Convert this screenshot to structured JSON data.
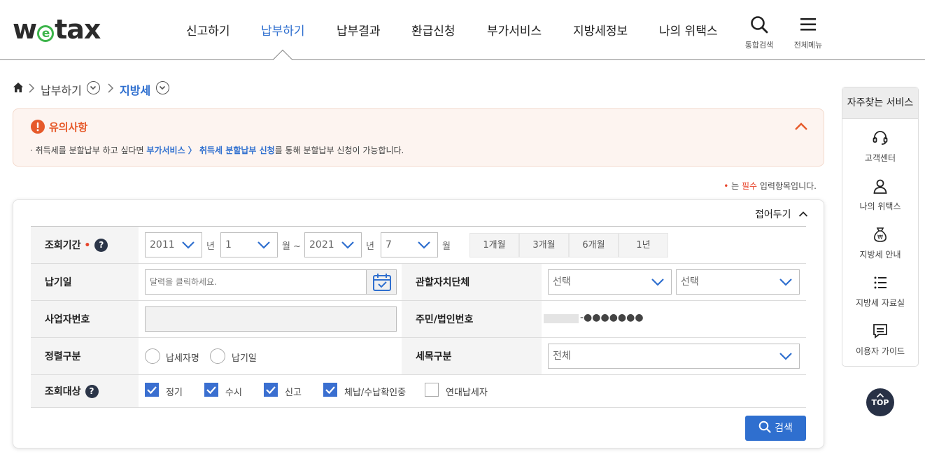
{
  "header": {
    "logo_text": "wetax",
    "nav": [
      "신고하기",
      "납부하기",
      "납부결과",
      "환급신청",
      "부가서비스",
      "지방세정보",
      "나의 위택스"
    ],
    "active_nav": "납부하기",
    "search_label": "통합검색",
    "menu_label": "전체메뉴",
    "accent_color": "#2f6fcf"
  },
  "breadcrumb": {
    "level1": "납부하기",
    "level2": "지방세"
  },
  "notice": {
    "title": "유의사항",
    "text_before": "· 취득세를 분할납부 하고 싶다면 ",
    "text_link": "부가서비스 〉 취득세 분할납부 신청",
    "text_after": "를 통해 분할납부 신청이 가능합니다."
  },
  "required_note": {
    "prefix": "는 ",
    "required": "필수",
    "suffix": " 입력항목입니다."
  },
  "form": {
    "collapse_label": "접어두기",
    "period": {
      "label": "조회기간",
      "from_year": "2011",
      "from_month": "1",
      "to_year": "2021",
      "to_month": "7",
      "unit_year": "년",
      "unit_month_tilde": "월 ~",
      "unit_month": "월",
      "quick_buttons": [
        "1개월",
        "3개월",
        "6개월",
        "1년"
      ]
    },
    "due_date": {
      "label": "납기일",
      "placeholder": "달력을 클릭하세요."
    },
    "jurisdiction": {
      "label": "관할자치단체",
      "select1": "선택",
      "select2": "선택"
    },
    "business_no": {
      "label": "사업자번호",
      "value": ""
    },
    "resident_no": {
      "label": "주민/법인번호",
      "masked": "-●●●●●●●"
    },
    "sort": {
      "label": "정렬구분",
      "options": [
        "납세자명",
        "납기일"
      ]
    },
    "tax_item": {
      "label": "세목구분",
      "value": "전체"
    },
    "target": {
      "label": "조회대상",
      "options": [
        {
          "label": "정기",
          "checked": true
        },
        {
          "label": "수시",
          "checked": true
        },
        {
          "label": "신고",
          "checked": true
        },
        {
          "label": "체납/수납확인중",
          "checked": true
        },
        {
          "label": "연대납세자",
          "checked": false
        }
      ]
    },
    "search_button": "검색"
  },
  "side_panel": {
    "title": "자주찾는 서비스",
    "items": [
      "고객센터",
      "나의 위택스",
      "지방세 안내",
      "지방세 자료실",
      "이용자 가이드"
    ],
    "top_label": "TOP"
  }
}
